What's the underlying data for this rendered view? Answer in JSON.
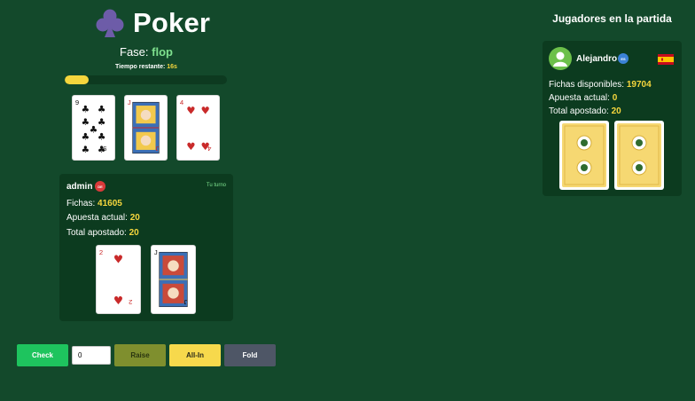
{
  "header": {
    "title": "Poker",
    "logo_icon": "club-icon"
  },
  "phase": {
    "label": "Fase:",
    "value": "flop"
  },
  "timer": {
    "label": "Tiempo restante:",
    "value": "16s",
    "progress": 0.15
  },
  "board": {
    "cards": [
      {
        "rank": "9",
        "suit": "clubs"
      },
      {
        "rank": "J",
        "suit": "diamonds"
      },
      {
        "rank": "4",
        "suit": "hearts"
      }
    ]
  },
  "player": {
    "name": "admin",
    "badge": "DE",
    "turn_label": "Tu turno",
    "chips_label": "Fichas:",
    "chips": "41605",
    "current_bet_label": "Apuesta actual:",
    "current_bet": "20",
    "total_bet_label": "Total apostado:",
    "total_bet": "20",
    "hand": [
      {
        "rank": "2",
        "suit": "hearts"
      },
      {
        "rank": "J",
        "suit": "clubs"
      }
    ]
  },
  "opponents_title": "Jugadores en la partida",
  "opponent": {
    "name": "Alejandro",
    "badge": "ES",
    "flag": "spain-flag",
    "chips_label": "Fichas disponibles:",
    "chips": "19704",
    "current_bet_label": "Apuesta actual:",
    "current_bet": "0",
    "total_bet_label": "Total apostado:",
    "total_bet": "20"
  },
  "actions": {
    "check": "Check",
    "bet_value": "0",
    "raise": "Raise",
    "allin": "All-In",
    "fold": "Fold"
  },
  "colors": {
    "background": "#13492b",
    "panel": "#0c3b1f",
    "accent_yellow": "#f5d63d",
    "accent_green": "#7ee08e",
    "check_button": "#1ec45e",
    "raise_button": "#7f8f2e",
    "allin_button": "#f7d94c",
    "fold_button": "#4e5666"
  }
}
